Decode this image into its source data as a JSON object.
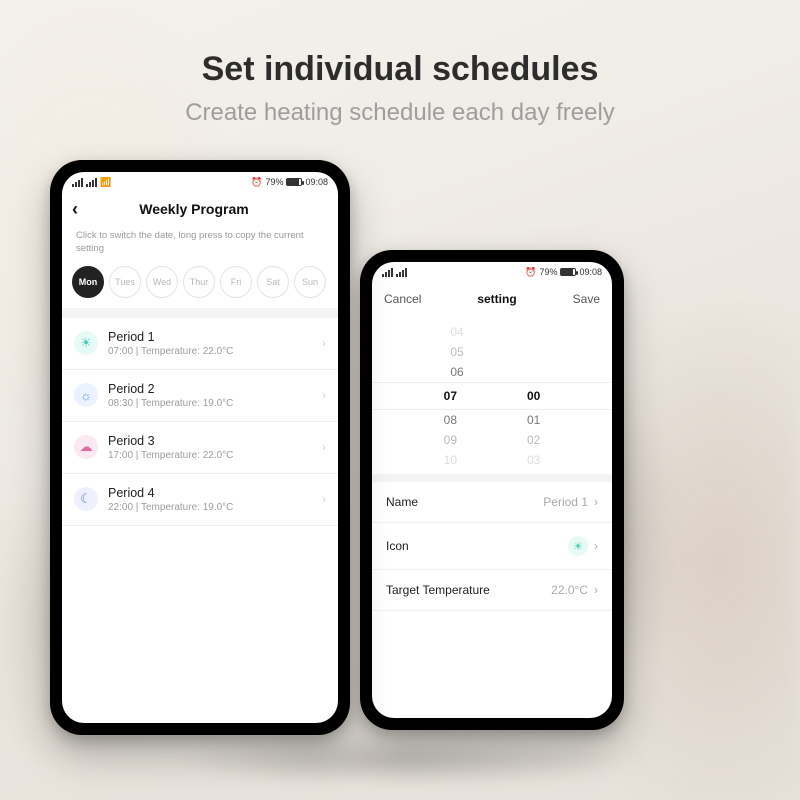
{
  "marketing": {
    "headline": "Set individual schedules",
    "subhead": "Create heating schedule each day freely"
  },
  "statusbar": {
    "battery_pct": "79%",
    "time": "09:08",
    "alarm_glyph": "⏰"
  },
  "phone1": {
    "nav_title": "Weekly Program",
    "hint": "Click to switch the date, long press to copy the current setting",
    "days": [
      "Mon",
      "Tues",
      "Wed",
      "Thur",
      "Fri",
      "Sat",
      "Sun"
    ],
    "active_day_index": 0,
    "periods": [
      {
        "title": "Period 1",
        "time": "07:00",
        "temp": "22.0°C",
        "icon": "sunrise"
      },
      {
        "title": "Period 2",
        "time": "08:30",
        "temp": "19.0°C",
        "icon": "sun"
      },
      {
        "title": "Period 3",
        "time": "17:00",
        "temp": "22.0°C",
        "icon": "sunset"
      },
      {
        "title": "Period 4",
        "time": "22:00",
        "temp": "19.0°C",
        "icon": "moon"
      }
    ],
    "sub_prefix_temp": "Temperature: ",
    "sub_sep": "  |  "
  },
  "phone2": {
    "cancel": "Cancel",
    "title": "setting",
    "save": "Save",
    "picker_hours": [
      "04",
      "05",
      "06",
      "07",
      "08",
      "09",
      "10"
    ],
    "picker_mins": [
      "",
      "",
      "",
      "00",
      "01",
      "02",
      "03"
    ],
    "picker_selected_index": 3,
    "rows": {
      "name_label": "Name",
      "name_value": "Period 1",
      "icon_label": "Icon",
      "temp_label": "Target Temperature",
      "temp_value": "22.0°C"
    }
  },
  "glyphs": {
    "back": "‹",
    "chev": "›",
    "sunrise": "☀",
    "sun": "☼",
    "sunset": "☁",
    "moon": "☾",
    "wifi": "📶"
  }
}
